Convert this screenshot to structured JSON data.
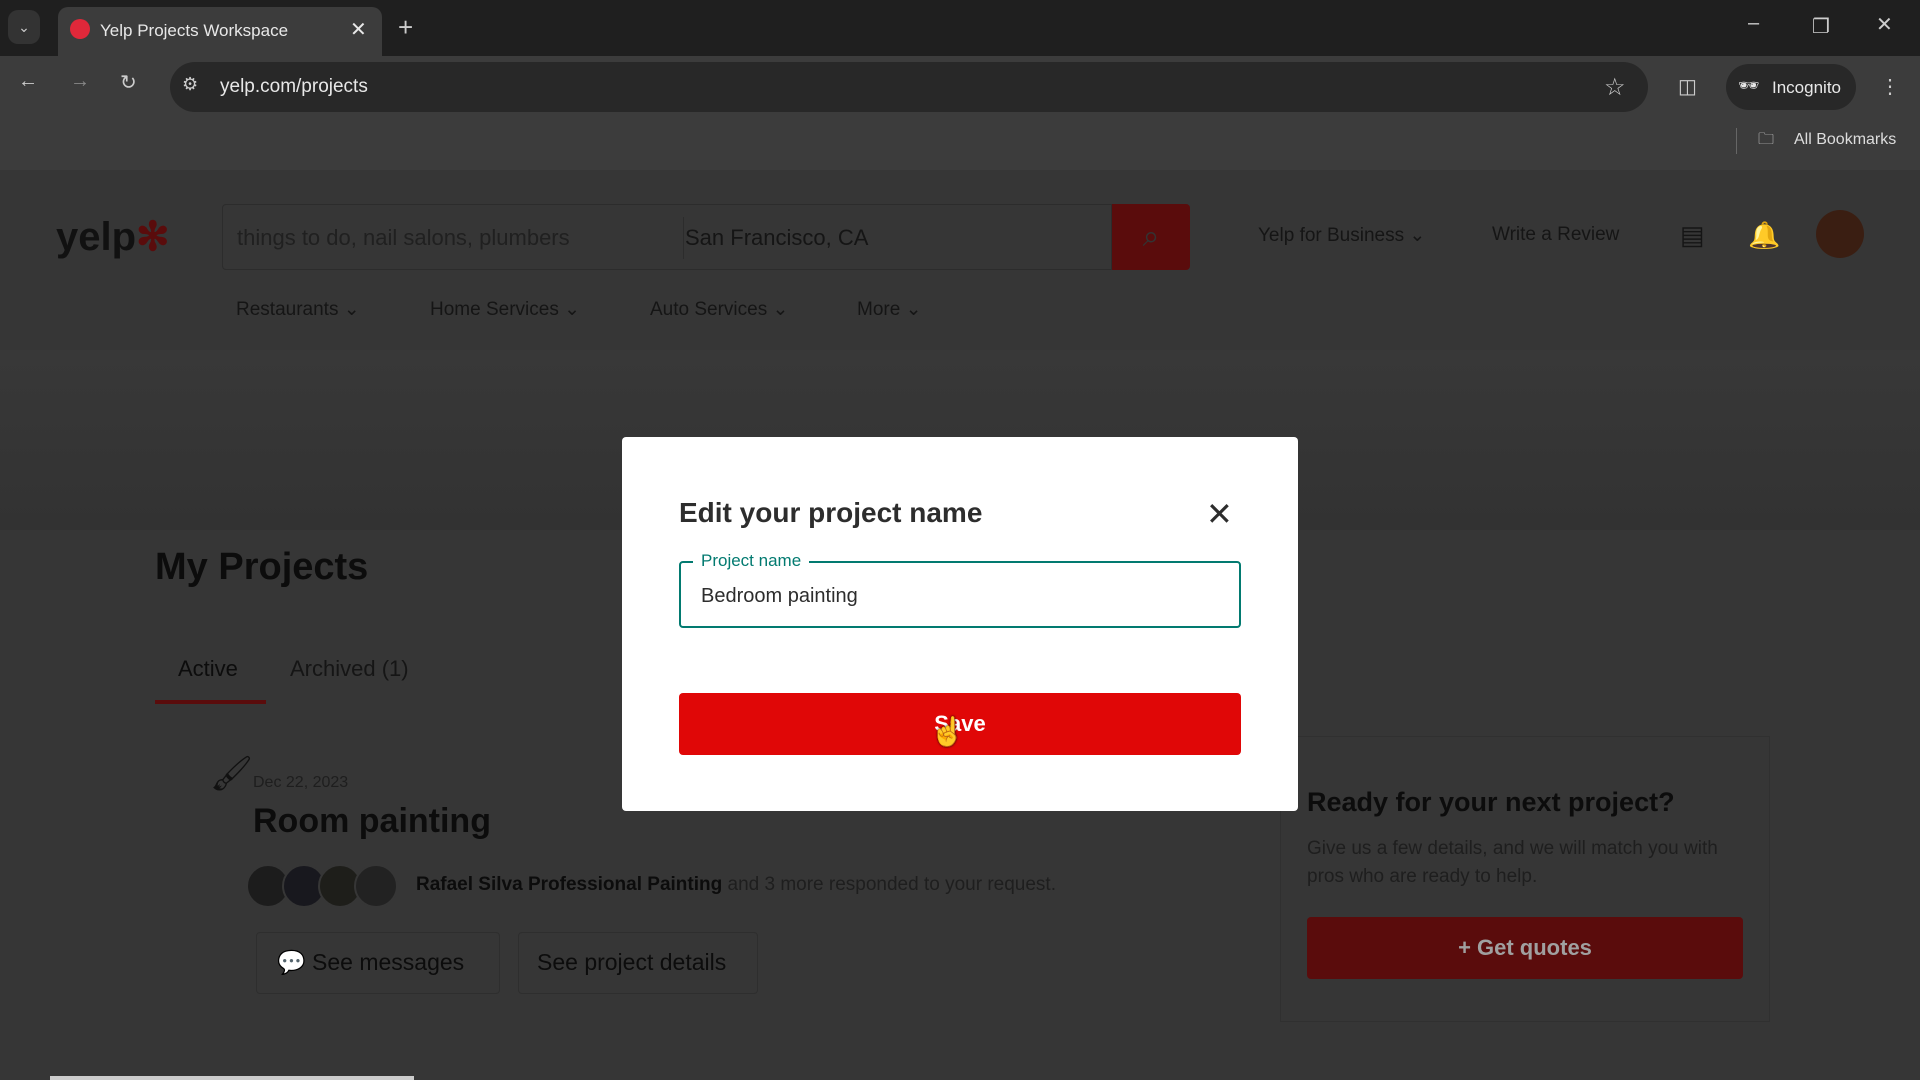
{
  "browser": {
    "tab_title": "Yelp Projects Workspace",
    "url": "yelp.com/projects",
    "incognito_label": "Incognito",
    "bookmarks_label": "All Bookmarks"
  },
  "header": {
    "logo": "yelp",
    "search_placeholder": "things to do, nail salons, plumbers",
    "location_placeholder": "San Francisco, CA",
    "yelp_for_business": "Yelp for Business",
    "write_review": "Write a Review"
  },
  "nav": [
    "Restaurants",
    "Home Services",
    "Auto Services",
    "More"
  ],
  "main": {
    "title": "My Projects",
    "tabs": [
      {
        "label": "Active"
      },
      {
        "label": "Archived (1)"
      }
    ],
    "project": {
      "date": "Dec 22, 2023",
      "title": "Room painting",
      "responder": "Rafael Silva Professional Painting",
      "responder_suffix": " and 3 more responded to your request.",
      "see_messages": "See messages",
      "see_details": "See project details"
    },
    "promo": {
      "title": "Ready for your next project?",
      "text": "Give us a few details, and we will match you with pros who are ready to help.",
      "button": "+ Get quotes"
    }
  },
  "modal": {
    "title": "Edit your project name",
    "field_label": "Project name",
    "field_value": "Bedroom painting",
    "save": "Save"
  },
  "colors": {
    "brand": "#e00707",
    "focus": "#027a70"
  }
}
